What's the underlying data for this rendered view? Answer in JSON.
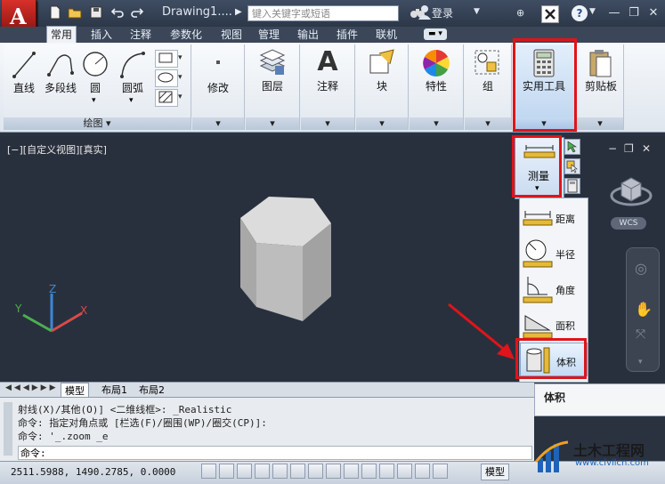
{
  "app": {
    "logo_letter": "A",
    "doc_title": "Drawing1....",
    "search_placeholder": "键入关键字或短语",
    "login": "登录"
  },
  "tabs": [
    "常用",
    "插入",
    "注释",
    "参数化",
    "视图",
    "管理",
    "输出",
    "插件",
    "联机"
  ],
  "ribbon": {
    "draw_tools": [
      "直线",
      "多段线",
      "圆",
      "圆弧"
    ],
    "draw_panel_label": "绘图",
    "panels": [
      "修改",
      "图层",
      "注释",
      "块",
      "特性",
      "组",
      "实用工具",
      "剪贴板"
    ]
  },
  "viewport": {
    "label": "[−][自定义视图][真实]",
    "wcs": "WCS",
    "axes": {
      "x": "X",
      "y": "Y",
      "z": "Z"
    }
  },
  "measure_flyout": {
    "label": "测量"
  },
  "measure_menu": [
    "距离",
    "半径",
    "角度",
    "面积",
    "体积"
  ],
  "tooltip": "体积",
  "layout_tabs": [
    "模型",
    "布局1",
    "布局2"
  ],
  "command_history": [
    "射线(X)/其他(O)] <二维线框>: _Realistic",
    "命令: 指定对角点或 [栏选(F)/圈围(WP)/圈交(CP)]:",
    "命令: '_.zoom _e"
  ],
  "command_prompt": "命令:",
  "status": {
    "coords": "2511.5988, 1490.2785, 0.0000",
    "model": "模型"
  },
  "watermark": {
    "title": "土木工程网",
    "url": "www.civilcn.com"
  }
}
